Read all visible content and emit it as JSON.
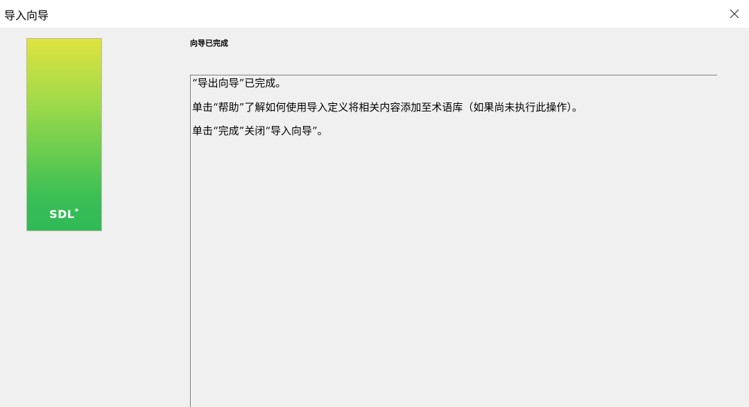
{
  "window": {
    "title": "导入向导",
    "close_icon": "close-icon"
  },
  "logo": {
    "brand": "SDL",
    "mark": "*",
    "colors": {
      "top": "#dfe33f",
      "bottom": "#2fb957"
    }
  },
  "page": {
    "heading": "向导已完成",
    "messages": [
      "“导出向导”已完成。",
      "单击“帮助”了解如何使用导入定义将相关内容添加至术语库（如果尚未执行此操作）。",
      "单击“完成”关闭“导入向导”。"
    ]
  }
}
